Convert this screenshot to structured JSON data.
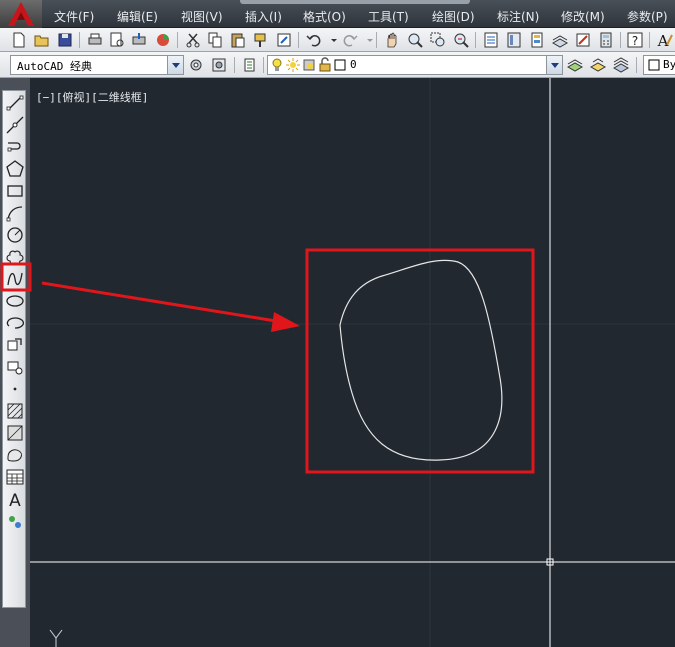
{
  "menu": {
    "items": [
      {
        "id": "file",
        "label": "文件(F)"
      },
      {
        "id": "edit",
        "label": "编辑(E)"
      },
      {
        "id": "view",
        "label": "视图(V)"
      },
      {
        "id": "insert",
        "label": "插入(I)"
      },
      {
        "id": "format",
        "label": "格式(O)"
      },
      {
        "id": "tools",
        "label": "工具(T)"
      },
      {
        "id": "draw",
        "label": "绘图(D)"
      },
      {
        "id": "dimension",
        "label": "标注(N)"
      },
      {
        "id": "modify",
        "label": "修改(M)"
      },
      {
        "id": "parameter",
        "label": "参数(P)"
      }
    ]
  },
  "workspace": {
    "value": "AutoCAD 经典"
  },
  "layer": {
    "value": "0"
  },
  "bylayer": {
    "value": "By"
  },
  "canvas": {
    "viewport_label": "[−][俯视][二维线框]",
    "highlight_color": "#e0161b",
    "crosshair_color": "#ffffff",
    "background": "#212830"
  },
  "left_toolbar": {
    "tools": [
      "line-icon",
      "construction-line-icon",
      "polyline-icon",
      "polygon-icon",
      "rectangle-icon",
      "arc-icon",
      "circle-icon",
      "revision-cloud-icon",
      "spline-icon",
      "ellipse-icon",
      "ellipse-arc-icon",
      "insert-block-icon",
      "make-block-icon",
      "point-icon",
      "hatch-icon",
      "gradient-icon",
      "region-icon",
      "table-icon",
      "multiline-text-icon",
      "add-selected-icon"
    ],
    "text_tool_glyph": "A",
    "highlighted_tool": "spline-icon"
  }
}
